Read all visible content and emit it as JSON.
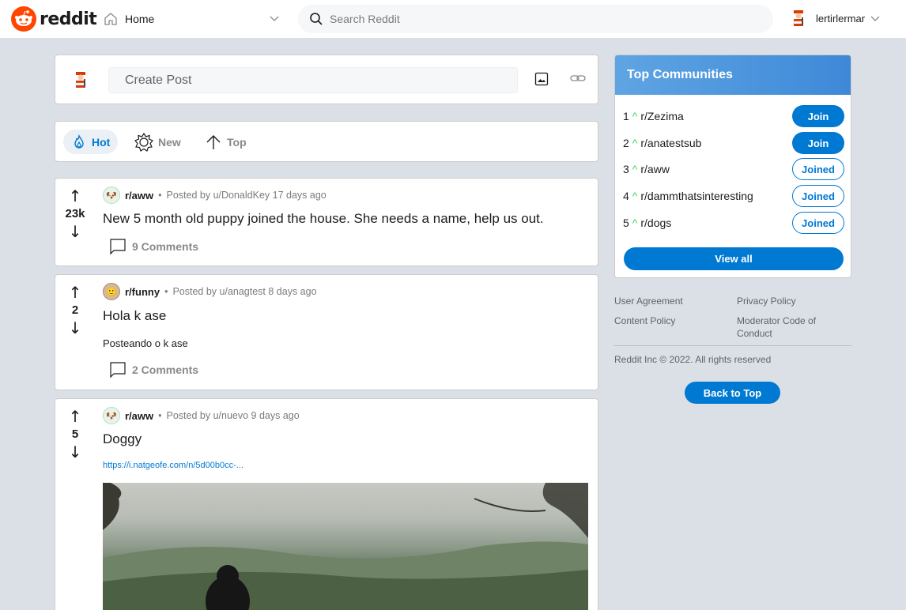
{
  "header": {
    "logo_text": "reddit",
    "home_label": "Home",
    "search_placeholder": "Search Reddit",
    "username": "lertirlermar"
  },
  "create_post": {
    "placeholder": "Create Post"
  },
  "sort_tabs": [
    {
      "label": "Hot",
      "active": true
    },
    {
      "label": "New",
      "active": false
    },
    {
      "label": "Top",
      "active": false
    }
  ],
  "posts": [
    {
      "subreddit": "r/aww",
      "posted_by": "Posted by u/DonaldKey 17 days ago",
      "votes": "23k",
      "title": "New 5 month old puppy joined the house. She needs a name, help us out.",
      "comments": "9 Comments"
    },
    {
      "subreddit": "r/funny",
      "posted_by": "Posted by u/anagtest 8 days ago",
      "votes": "2",
      "title": "Hola k ase",
      "body": "Posteando o k ase",
      "comments": "2 Comments"
    },
    {
      "subreddit": "r/aww",
      "posted_by": "Posted by u/nuevo 9 days ago",
      "votes": "5",
      "title": "Doggy",
      "link": "https://i.natgeofe.com/n/5d00b0cc-..."
    }
  ],
  "top_communities": {
    "title": "Top Communities",
    "items": [
      {
        "rank": "1",
        "name": "r/Zezima",
        "action": "Join"
      },
      {
        "rank": "2",
        "name": "r/anatestsub",
        "action": "Join"
      },
      {
        "rank": "3",
        "name": "r/aww",
        "action": "Joined"
      },
      {
        "rank": "4",
        "name": "r/dammthatsinteresting",
        "action": "Joined"
      },
      {
        "rank": "5",
        "name": "r/dogs",
        "action": "Joined"
      }
    ],
    "view_all": "View all"
  },
  "footer": {
    "user_agreement": "User Agreement",
    "privacy_policy": "Privacy Policy",
    "content_policy": "Content Policy",
    "moderator_code": "Moderator Code of Conduct",
    "copyright": "Reddit Inc © 2022. All rights reserved",
    "back_to_top": "Back to Top"
  },
  "colors": {
    "brand": "#ff4500",
    "accent": "#0079d3",
    "background": "#dae0e6",
    "upvote_green": "#46d160"
  }
}
